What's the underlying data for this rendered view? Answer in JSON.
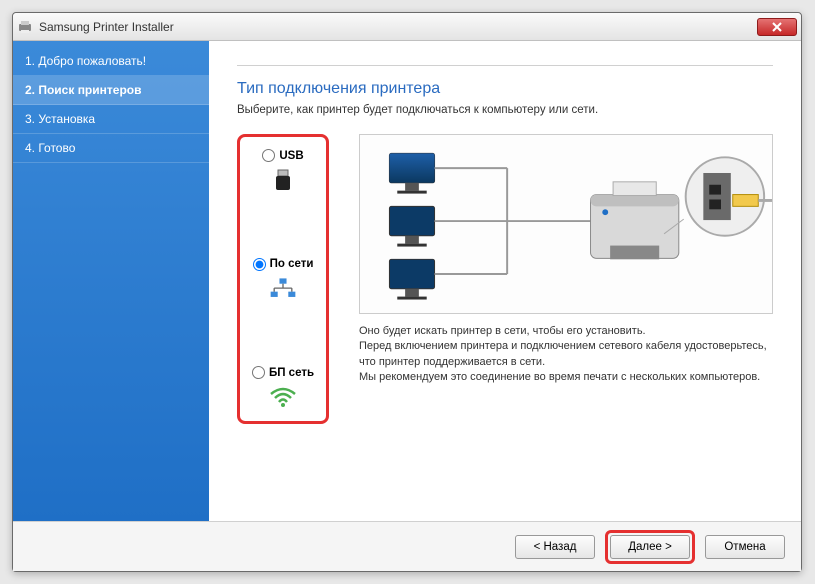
{
  "window": {
    "title": "Samsung Printer Installer"
  },
  "sidebar": {
    "steps": [
      {
        "label": "1. Добро пожаловать!"
      },
      {
        "label": "2. Поиск принтеров"
      },
      {
        "label": "3. Установка"
      },
      {
        "label": "4. Готово"
      }
    ],
    "activeIndex": 1
  },
  "main": {
    "title": "Тип подключения принтера",
    "description": "Выберите, как принтер будет подключаться к компьютеру или сети."
  },
  "options": {
    "usb": {
      "label": "USB",
      "selected": false
    },
    "network": {
      "label": "По сети",
      "selected": true
    },
    "wireless": {
      "label": "БП сеть",
      "selected": false
    }
  },
  "info": {
    "line1": "Оно будет искать принтер в сети, чтобы его установить.",
    "line2": "Перед включением принтера и подключением сетевого кабеля удостоверьтесь, что принтер поддерживается в сети.",
    "line3": "Мы рекомендуем это соединение во время печати с нескольких компьютеров."
  },
  "footer": {
    "back": "< Назад",
    "next": "Далее  >",
    "cancel": "Отмена"
  }
}
